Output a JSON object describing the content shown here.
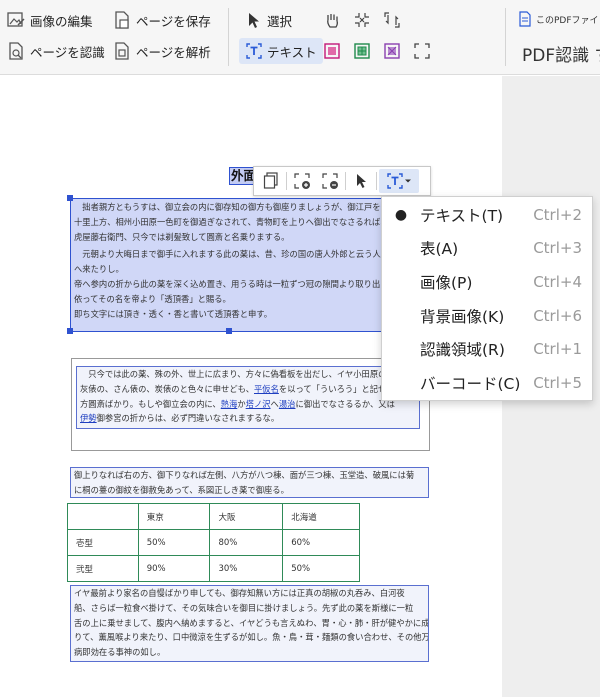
{
  "toolbar": {
    "edit_image": "画像の編集",
    "save_page": "ページを保存",
    "recognize_page": "ページを認識",
    "analyze_page": "ページを解析",
    "select": "選択",
    "text": "テキスト",
    "pdf_recognition": "PDF認識 す",
    "pdf_file_small": "このPDFファイ"
  },
  "document": {
    "heading": "外面",
    "para1": [
      "　拙者親方ともうすは、御立会の内に御存知の御方も御座りましょうが、御江戸を発って二",
      "十里上方、相州小田原一色町を御過ぎなされて、青物町を上りへ御出でなさるれば、欄干橋",
      "虎屋藤右衛門、只今では剃髪致して圓斎と名乗りまする。",
      "　元朝より大晦日まで御手に入れまする此の薬は、昔、珍の国の唐人外郎と云う人、我が朝",
      "へ来たりし。",
      "帝へ参内の折から此の薬を深く込め置き、用うる時は一粒ずつ冠の隙間より取り出す。",
      "依ってその名を帝より「透頂香」と賜る。",
      "即ち文字には頂き・透く・香と書いて透頂香と申す。"
    ],
    "para2": {
      "line1": "　只今では此の薬、殊の外、世上に広まり、方々に偽看板を出だし、イヤ小田原の、",
      "line2_a": "灰俵の、さん俵の、炭俵のと色々に申せども、",
      "line2_link": "平仮名",
      "line2_b": "を以って「ういろう」と記せしは親",
      "line3": "方圓斎ばかり。もしや御立会の内に、",
      "line3_link1": "熱海",
      "line3_mid1": "か",
      "line3_link2": "塔ノ沢",
      "line3_mid2": "へ",
      "line3_link3": "湯治",
      "line3_b": "に御出でなさるるか、又は",
      "line4_link": "伊勢",
      "line4_b": "御参宮の折からは、必ず門違いなされまするな。"
    },
    "para3": [
      "御上りなれば右の方、御下りなれば左側、八方が八つ棟、面が三つ棟、玉堂造、破風には菊",
      "に桐の薹の御紋を御赦免あって、系図正しき薬で御座る。"
    ],
    "para4": [
      "イヤ最前より家名の自慢ばかり申しても、御存知無い方には正真の胡椒の丸呑み、白河夜",
      "船、さらば一粒食べ掛けて、その気味合いを御目に掛けましょう。先ず此の薬を斯様に一粒",
      "舌の上に乗せまして、腹内へ納めますると、イヤどうも言えぬわ、胃・心・肺・肝が健やかに成",
      "りて、薫風喉より来たり、口中微涼を生ずるが如し。魚・鳥・茸・麺類の食い合わせ、その他万",
      "病即効在る事神の如し。"
    ]
  },
  "table": {
    "headers": [
      "",
      "東京",
      "大阪",
      "北海道"
    ],
    "rows": [
      [
        "壱型",
        "50%",
        "80%",
        "60%"
      ],
      [
        "弐型",
        "90%",
        "30%",
        "50%"
      ]
    ]
  },
  "menu": {
    "items": [
      {
        "label": "テキスト(T)",
        "shortcut": "Ctrl+2",
        "bullet": "●"
      },
      {
        "label": "表(A)",
        "shortcut": "Ctrl+3",
        "bullet": ""
      },
      {
        "label": "画像(P)",
        "shortcut": "Ctrl+4",
        "bullet": ""
      },
      {
        "label": "背景画像(K)",
        "shortcut": "Ctrl+6",
        "bullet": ""
      },
      {
        "label": "認識領域(R)",
        "shortcut": "Ctrl+1",
        "bullet": ""
      },
      {
        "label": "バーコード(C)",
        "shortcut": "Ctrl+5",
        "bullet": ""
      }
    ]
  },
  "colors": {
    "accent": "#2f52d0",
    "table_border": "#2f8a58",
    "selection": "#aab6f0"
  }
}
